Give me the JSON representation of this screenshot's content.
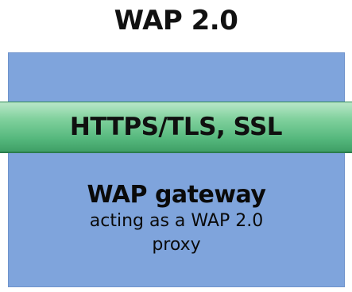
{
  "title": "WAP 2.0",
  "band": {
    "label": "HTTPS/TLS, SSL"
  },
  "gateway": {
    "title": "WAP gateway",
    "line1": "acting as a WAP 2.0",
    "line2": "proxy"
  },
  "colors": {
    "block": "#7fa4dc",
    "band_top": "#b9e7c8",
    "band_bottom": "#3f9f66"
  }
}
